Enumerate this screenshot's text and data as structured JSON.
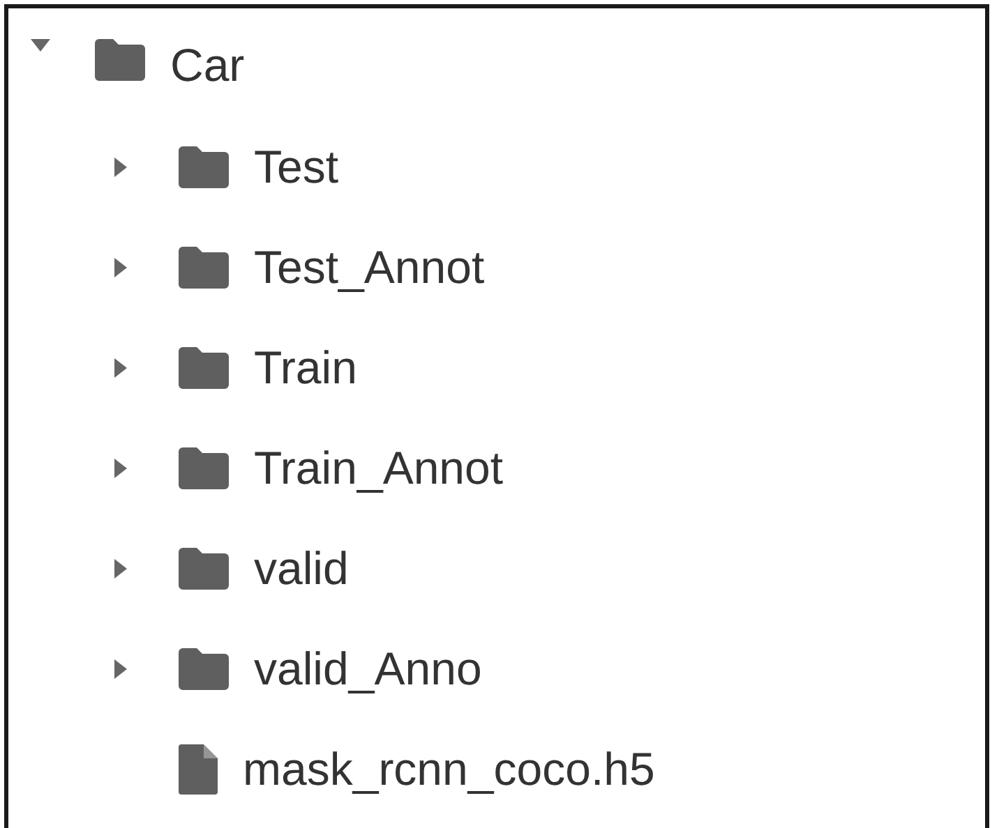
{
  "tree": [
    {
      "label": "Car",
      "kind": "folder",
      "expanded": true,
      "children": [
        {
          "label": "Test",
          "kind": "folder",
          "expanded": false
        },
        {
          "label": "Test_Annot",
          "kind": "folder",
          "expanded": false
        },
        {
          "label": "Train",
          "kind": "folder",
          "expanded": false
        },
        {
          "label": "Train_Annot",
          "kind": "folder",
          "expanded": false
        },
        {
          "label": "valid",
          "kind": "folder",
          "expanded": false
        },
        {
          "label": "valid_Anno",
          "kind": "folder",
          "expanded": false
        },
        {
          "label": "mask_rcnn_coco.h5",
          "kind": "file"
        }
      ]
    }
  ]
}
